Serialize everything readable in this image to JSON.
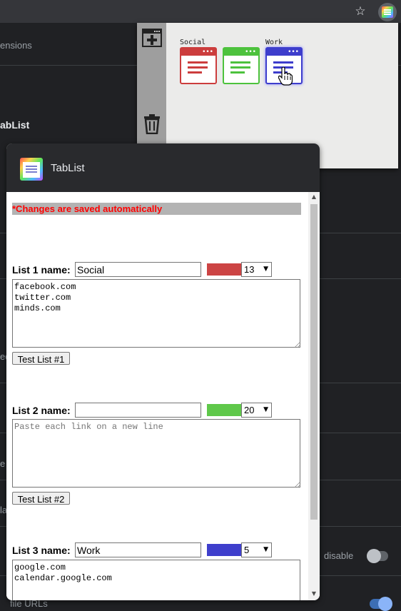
{
  "toolbar": {
    "bookmark_icon": "star-outline-icon",
    "extension_icon": "tablist-extension-icon"
  },
  "background": {
    "items": [
      "ensions",
      "abList",
      "ab",
      "ed",
      "e",
      "la",
      "disable",
      "file URLs"
    ]
  },
  "popup": {
    "add_icon": "add-window-icon",
    "trash_icon": "trash-icon",
    "settings_icon": "gear-icon",
    "lists": [
      {
        "label": "Social",
        "color": "#cc3d3d"
      },
      {
        "label": "",
        "color": "#4dc23d"
      },
      {
        "label": "Work",
        "color": "#3d3dcc"
      }
    ]
  },
  "dialog": {
    "title": "TabList",
    "notice": "*Changes are saved automatically",
    "lists": [
      {
        "label": "List 1 name:",
        "name_value": "Social",
        "color": "#cc4444",
        "count": "13",
        "links": "facebook.com\ntwitter.com\nminds.com",
        "placeholder": "Paste each link on a new line",
        "test_label": "Test List #1"
      },
      {
        "label": "List 2 name:",
        "name_value": "",
        "color": "#5fc84a",
        "count": "20",
        "links": "",
        "placeholder": "Paste each link on a new line",
        "test_label": "Test List #2"
      },
      {
        "label": "List 3 name:",
        "name_value": "Work",
        "color": "#3f3fcc",
        "count": "5",
        "links": "google.com\ncalendar.google.com",
        "placeholder": "Paste each link on a new line",
        "test_label": ""
      }
    ]
  }
}
